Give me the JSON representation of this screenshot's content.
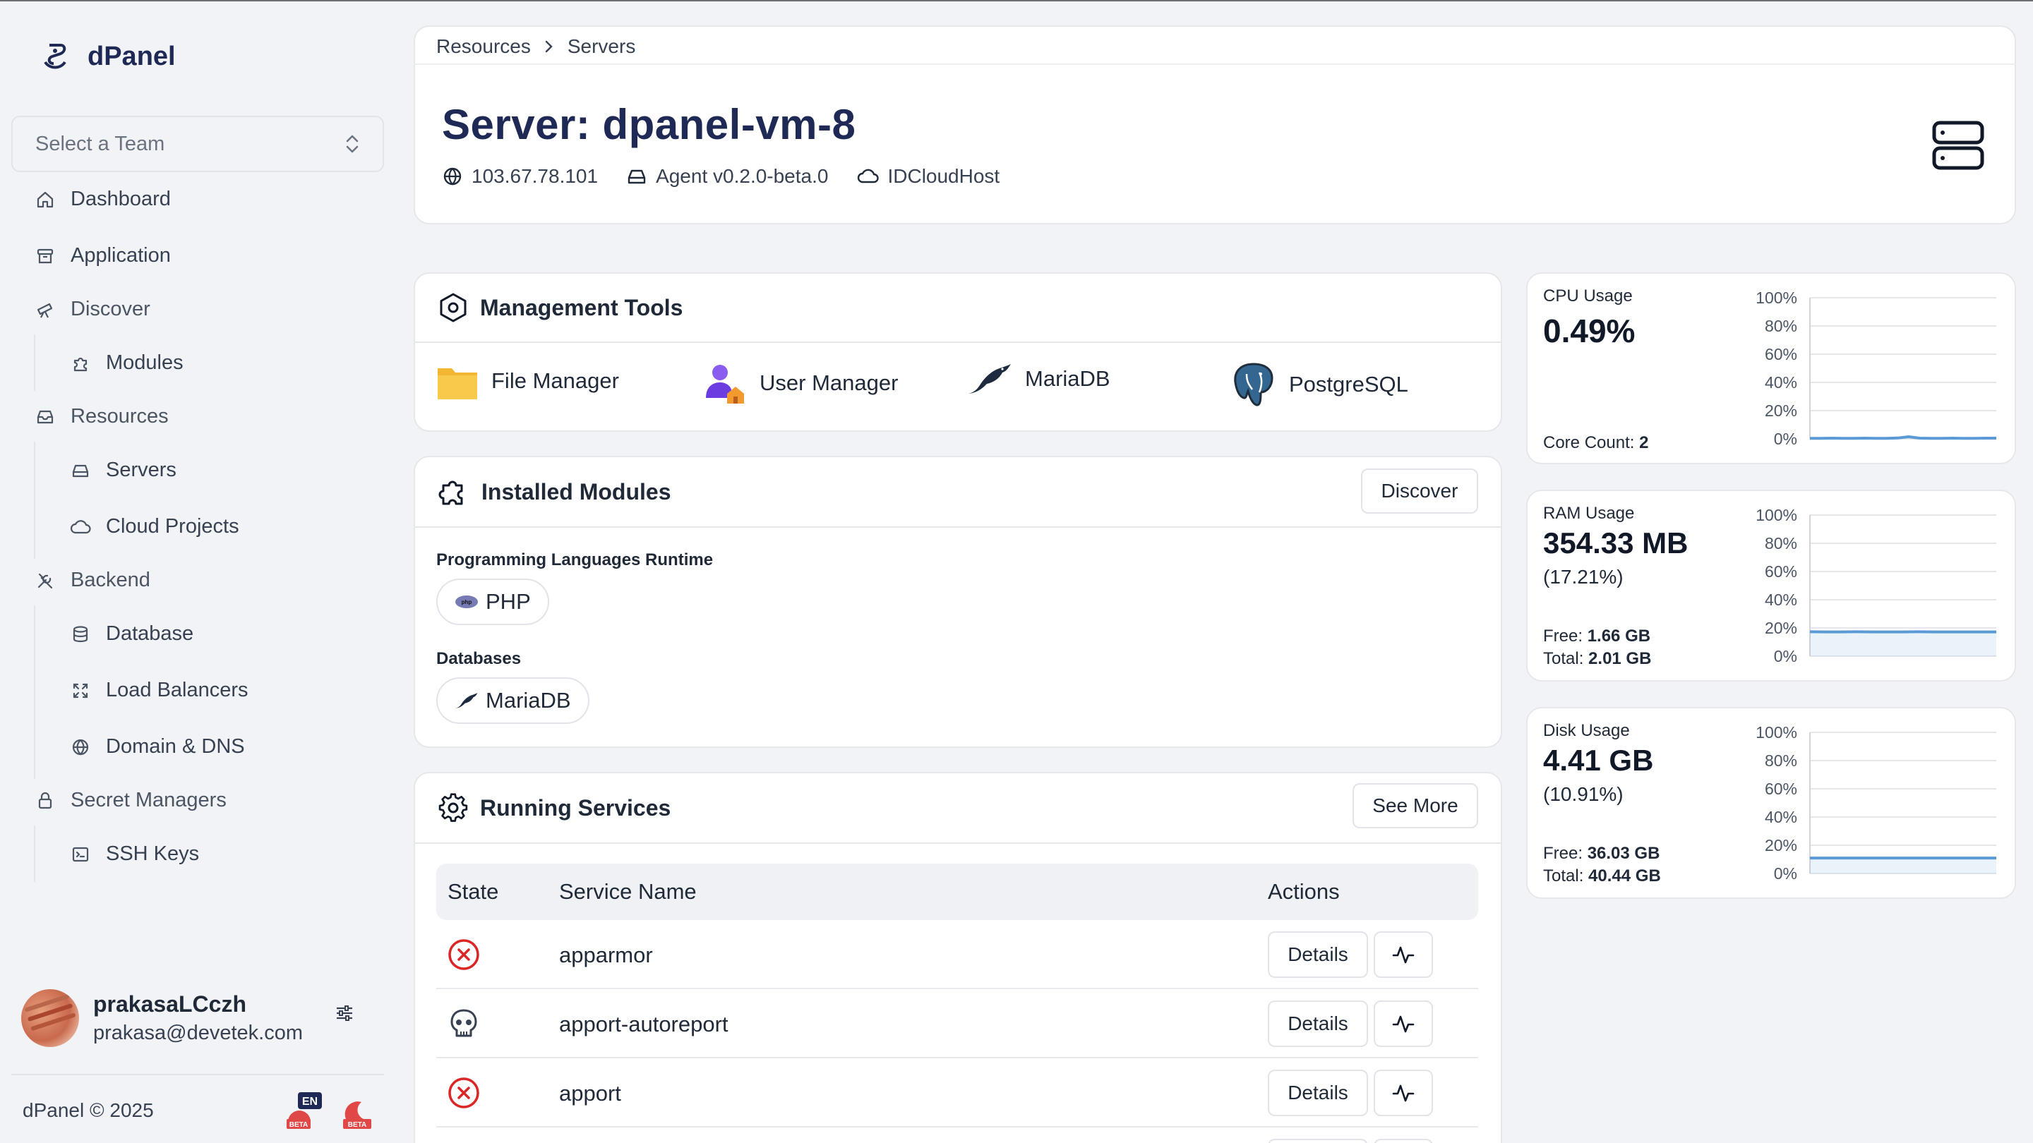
{
  "brand": {
    "name": "dPanel"
  },
  "team_select": {
    "placeholder": "Select a Team"
  },
  "nav": {
    "dashboard": "Dashboard",
    "application": "Application",
    "discover": "Discover",
    "modules": "Modules",
    "resources": "Resources",
    "servers": "Servers",
    "cloud_projects": "Cloud Projects",
    "backend": "Backend",
    "database": "Database",
    "load_balancers": "Load Balancers",
    "domain_dns": "Domain & DNS",
    "secret_managers": "Secret Managers",
    "ssh_keys": "SSH Keys"
  },
  "user": {
    "name": "prakasaLCczh",
    "email": "prakasa@devetek.com"
  },
  "footer": {
    "copyright": "dPanel © 2025",
    "lang_badge": "EN",
    "beta_badge": "BETA"
  },
  "breadcrumb": {
    "root": "Resources",
    "current": "Servers"
  },
  "server": {
    "title": "Server: dpanel-vm-8",
    "ip": "103.67.78.101",
    "agent": "Agent v0.2.0-beta.0",
    "provider": "IDCloudHost"
  },
  "management_tools": {
    "title": "Management Tools",
    "items": [
      {
        "label": "File Manager",
        "icon": "folder-icon"
      },
      {
        "label": "User Manager",
        "icon": "user-home-icon"
      },
      {
        "label": "MariaDB",
        "icon": "mariadb-seal-icon"
      },
      {
        "label": "PostgreSQL",
        "icon": "postgresql-elephant-icon"
      }
    ]
  },
  "installed_modules": {
    "title": "Installed Modules",
    "discover_label": "Discover",
    "groups": [
      {
        "label": "Programming Languages Runtime",
        "chips": [
          "PHP"
        ]
      },
      {
        "label": "Databases",
        "chips": [
          "MariaDB"
        ]
      }
    ]
  },
  "running_services": {
    "title": "Running Services",
    "see_more_label": "See More",
    "columns": [
      "State",
      "Service Name",
      "Actions"
    ],
    "details_label": "Details",
    "rows": [
      {
        "state": "failed",
        "state_icon": "x-circle-icon",
        "name": "apparmor"
      },
      {
        "state": "dead",
        "state_icon": "skull-icon",
        "name": "apport-autoreport"
      },
      {
        "state": "failed",
        "state_icon": "x-circle-icon",
        "name": "apport"
      }
    ]
  },
  "stats": {
    "cpu": {
      "label": "CPU Usage",
      "value": "0.49%",
      "core_label": "Core Count:",
      "core_value": "2"
    },
    "ram": {
      "label": "RAM Usage",
      "value": "354.33 MB",
      "percent": "(17.21%)",
      "free_label": "Free:",
      "free_value": "1.66 GB",
      "total_label": "Total:",
      "total_value": "2.01 GB"
    },
    "disk": {
      "label": "Disk Usage",
      "value": "4.41 GB",
      "percent": "(10.91%)",
      "free_label": "Free:",
      "free_value": "36.03 GB",
      "total_label": "Total:",
      "total_value": "40.44 GB"
    }
  },
  "chart_data": [
    {
      "type": "line",
      "title": "CPU Usage",
      "y_ticks": [
        "100%",
        "80%",
        "60%",
        "40%",
        "20%",
        "0%"
      ],
      "ylim": [
        0,
        100
      ],
      "series": [
        {
          "values": [
            0.4,
            0.4,
            0.5,
            0.4,
            0.4,
            0.5,
            0.4,
            0.4,
            0.6,
            1.5,
            0.5,
            0.4,
            0.4,
            0.5,
            0.4,
            0.4,
            0.5,
            0.49
          ]
        }
      ],
      "color": "#5b9bd5"
    },
    {
      "type": "area",
      "title": "RAM Usage",
      "y_ticks": [
        "100%",
        "80%",
        "60%",
        "40%",
        "20%",
        "0%"
      ],
      "ylim": [
        0,
        100
      ],
      "series": [
        {
          "values": [
            17.3,
            17.2,
            17.2,
            17.3,
            17.2,
            17.2,
            17.2,
            17.3,
            17.2,
            17.2,
            17.2,
            17.2,
            17.21
          ]
        }
      ],
      "color": "#5b9bd5"
    },
    {
      "type": "area",
      "title": "Disk Usage",
      "y_ticks": [
        "100%",
        "80%",
        "60%",
        "40%",
        "20%",
        "0%"
      ],
      "ylim": [
        0,
        100
      ],
      "series": [
        {
          "values": [
            10.91,
            10.91,
            10.91,
            10.91,
            10.91,
            10.91,
            10.91,
            10.91,
            10.91,
            10.91,
            10.91,
            10.91,
            10.91
          ]
        }
      ],
      "color": "#5b9bd5"
    }
  ]
}
